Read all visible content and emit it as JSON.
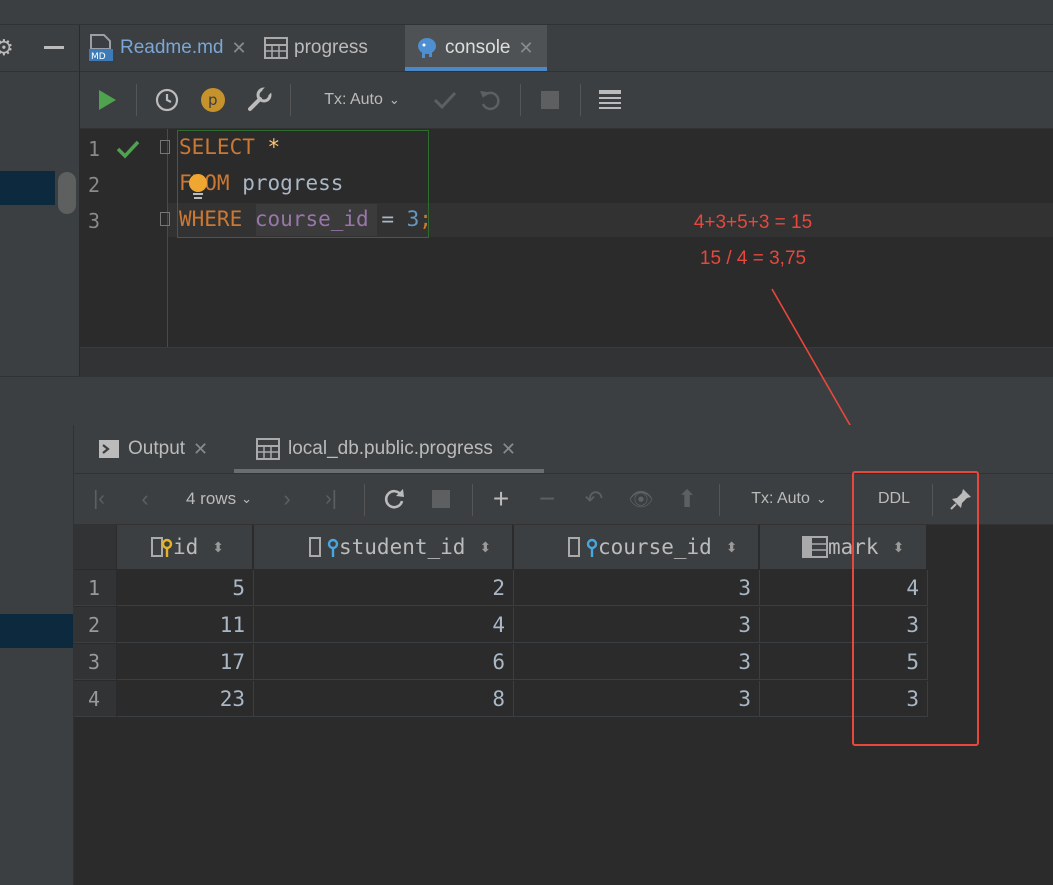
{
  "editor_tabs": [
    {
      "label": "Readme.md",
      "icon": "markdown-file-icon",
      "active": false
    },
    {
      "label": "progress",
      "icon": "table-icon",
      "active": false
    },
    {
      "label": "console",
      "icon": "postgresql-icon",
      "active": true
    }
  ],
  "editor_toolbar": {
    "tx_mode": "Tx: Auto"
  },
  "editor": {
    "line_numbers": [
      "1",
      "2",
      "3"
    ],
    "lines": [
      {
        "keyword": "SELECT",
        "rest": "*"
      },
      {
        "keyword": "FROM",
        "rest": "progress"
      },
      {
        "keyword": "WHERE",
        "column": "course_id",
        "operator": "=",
        "value": "3",
        "terminator": ";"
      }
    ]
  },
  "annotation": {
    "line1": "4+3+5+3 = 15",
    "line2": "15 / 4 = 3,75",
    "color": "#e8473c"
  },
  "results_tabs": [
    {
      "label": "Output",
      "icon": "console-output-icon",
      "active": false
    },
    {
      "label": "local_db.public.progress",
      "icon": "table-icon",
      "active": true
    }
  ],
  "results_toolbar": {
    "rows_label": "4 rows",
    "tx_mode": "Tx: Auto",
    "ddl_label": "DDL"
  },
  "grid": {
    "columns": [
      "id",
      "student_id",
      "course_id",
      "mark"
    ],
    "rows": [
      {
        "n": "1",
        "id": "5",
        "student_id": "2",
        "course_id": "3",
        "mark": "4"
      },
      {
        "n": "2",
        "id": "11",
        "student_id": "4",
        "course_id": "3",
        "mark": "3"
      },
      {
        "n": "3",
        "id": "17",
        "student_id": "6",
        "course_id": "3",
        "mark": "5"
      },
      {
        "n": "4",
        "id": "23",
        "student_id": "8",
        "course_id": "3",
        "mark": "3"
      }
    ]
  }
}
